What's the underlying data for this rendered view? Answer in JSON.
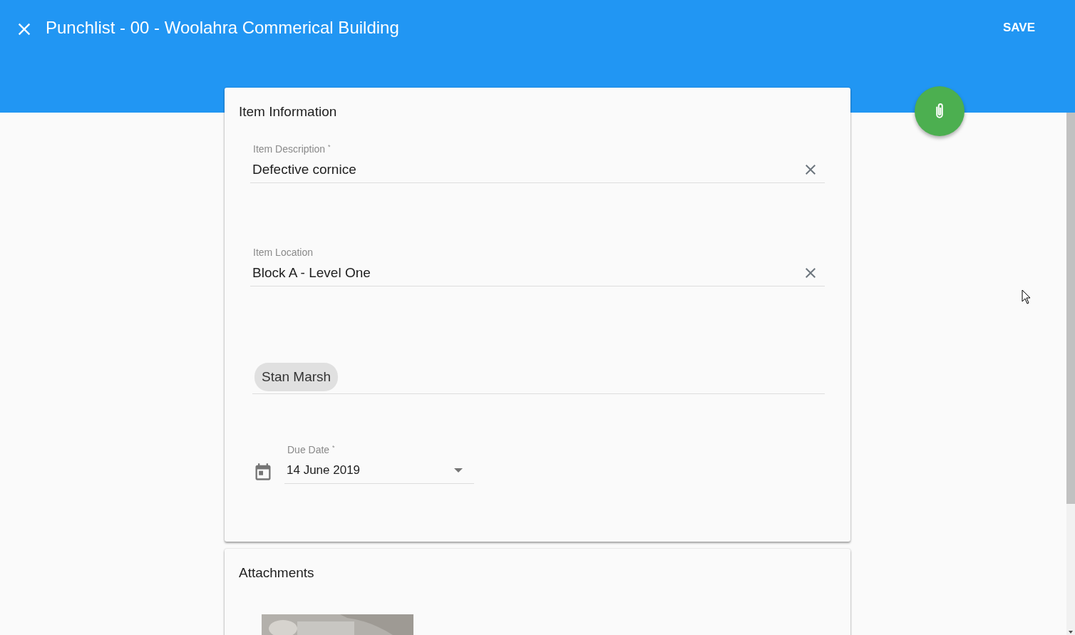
{
  "app_bar": {
    "title": "Punchlist - 00 - Woolahra Commerical Building",
    "action": "SAVE"
  },
  "item_information": {
    "title": "Item Information",
    "fields": [
      {
        "kind": "text",
        "label": "Item Description $^{*}$",
        "value": "Defective cornice"
      },
      {
        "kind": "text",
        "label": "Item Location",
        "value": "Block A - Level One"
      },
      {
        "kind": "chips",
        "chips": [
          "Stan Marsh"
        ]
      },
      {
        "kind": "date",
        "label": "Due Date $^{*}$",
        "value": "14 June 2019"
      }
    ]
  },
  "attachments": {
    "title": "Attachments"
  }
}
